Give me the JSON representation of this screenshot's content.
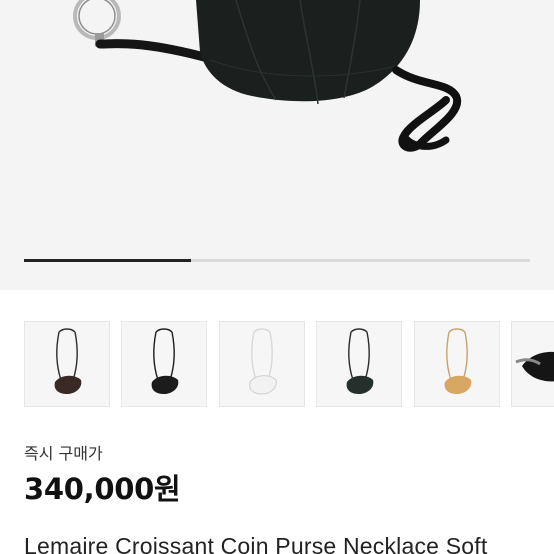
{
  "product": {
    "instant_buy_label": "즉시 구매가",
    "price": "340,000원",
    "title": "Lemaire Croissant Coin Purse Necklace Soft"
  },
  "gallery": {
    "current_index": 1,
    "progress_fraction": 0.33,
    "thumbnails": [
      {
        "name": "thumbnail-brown",
        "color": "#3a2a24",
        "strap": "#2b2b2b"
      },
      {
        "name": "thumbnail-black",
        "color": "#1c1c1c",
        "strap": "#1c1c1c"
      },
      {
        "name": "thumbnail-white",
        "color": "#f2f2f2",
        "strap": "#d9d9d9"
      },
      {
        "name": "thumbnail-dark-green",
        "color": "#25302c",
        "strap": "#2a2a2a"
      },
      {
        "name": "thumbnail-tan",
        "color": "#d8a763",
        "strap": "#c9a26c"
      },
      {
        "name": "thumbnail-black-detail",
        "color": "#151515",
        "strap": "#151515"
      }
    ]
  }
}
